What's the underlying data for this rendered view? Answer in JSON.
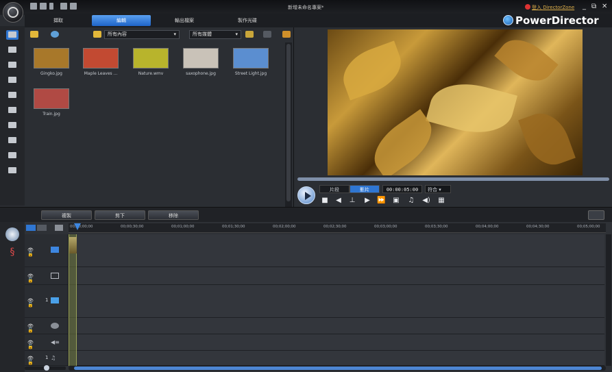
{
  "app": {
    "document_title": "新增未命名專案*",
    "brand": "PowerDirector",
    "signin_label": "登入 DirectorZone",
    "window_controls": [
      "_",
      "⧉",
      "✕"
    ]
  },
  "tabs": [
    {
      "label": "擷取",
      "active": false
    },
    {
      "label": "編輯",
      "active": true
    },
    {
      "label": "輸出檔案",
      "active": false
    },
    {
      "label": "製作光碟",
      "active": false
    }
  ],
  "library": {
    "content_filter": "所有內容",
    "media_filter": "所有媒體",
    "items": [
      {
        "name": "Gingko.jpg",
        "color": "#a8782a"
      },
      {
        "name": "Maple Leaves ...",
        "color": "#c24a32"
      },
      {
        "name": "Nature.wmv",
        "color": "#b8b42c"
      },
      {
        "name": "saxophone.jpg",
        "color": "#c9c2b8"
      },
      {
        "name": "Street Light.jpg",
        "color": "#5b8ed0"
      },
      {
        "name": "Train.jpg",
        "color": "#b04a44"
      }
    ]
  },
  "preview": {
    "mode_clip": "片段",
    "mode_movie": "影片",
    "timecode": "00:00:05:00",
    "fit_label": "符合",
    "progress": 1.0
  },
  "actionbar": {
    "buttons": [
      "複製",
      "剪下",
      "移除"
    ]
  },
  "timeline": {
    "ruler_ticks": [
      "00;00;00;00",
      "00;00;30;00",
      "00;01;00;00",
      "00;01;30;00",
      "00;02;00;00",
      "00;02;30;00",
      "00;03;00;00",
      "00;03;30;00",
      "00;04;00;00",
      "00;04;30;00",
      "00;05;00;00"
    ],
    "tracks": [
      {
        "name": "video-track-1",
        "icon": "video-icon"
      },
      {
        "name": "effect-track",
        "icon": "effect-icon"
      },
      {
        "name": "pip-track-1",
        "icon": "pip-icon",
        "index": "1"
      },
      {
        "name": "title-track",
        "icon": "title-icon"
      },
      {
        "name": "voice-track",
        "icon": "voice-icon"
      },
      {
        "name": "music-track",
        "icon": "music-icon",
        "index": "1"
      }
    ]
  }
}
